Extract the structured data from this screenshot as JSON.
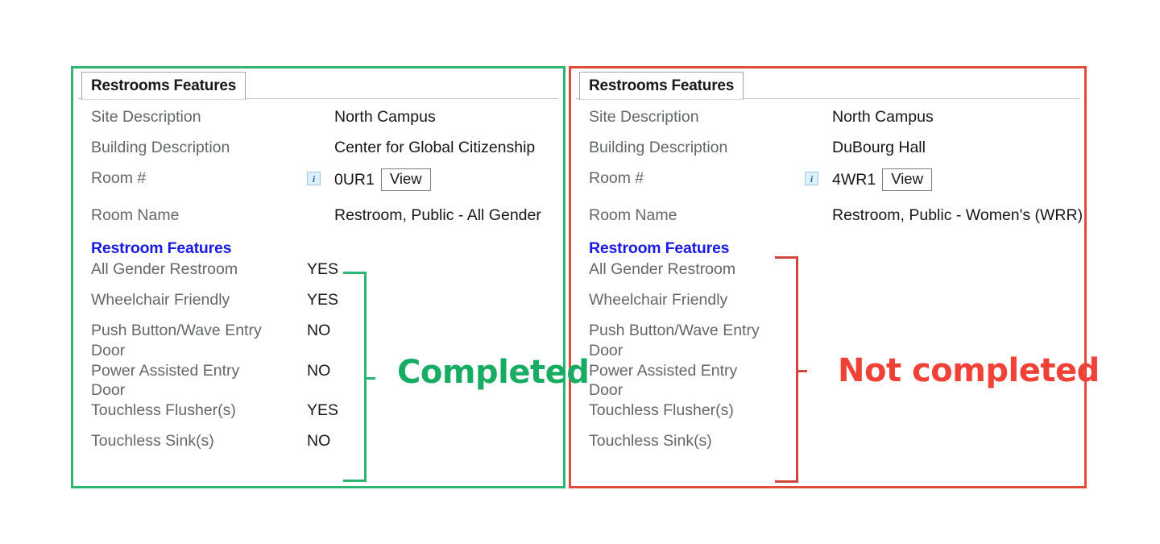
{
  "accent": {
    "green": "#2cb673",
    "red": "#e24a3b",
    "link_blue": "#1a1ae0",
    "label_gray": "#636769"
  },
  "panels": [
    {
      "status_key": "completed",
      "border_color": "#2cb673",
      "tab_label": "Restrooms Features",
      "info_icon": "info-icon",
      "fields": [
        {
          "label": "Site Description",
          "value": "North Campus",
          "has_info": false,
          "has_button": false
        },
        {
          "label": "Building Description",
          "value": "Center for Global Citizenship",
          "has_info": false,
          "has_button": false
        },
        {
          "label": "Room #",
          "value": "0UR1",
          "has_info": true,
          "has_button": true,
          "button_label": "View"
        },
        {
          "label": "Room Name",
          "value": "Restroom, Public - All Gender",
          "has_info": false,
          "has_button": false
        }
      ],
      "section_heading": "Restroom Features",
      "features": [
        {
          "label": "All Gender Restroom",
          "value": "YES"
        },
        {
          "label": "Wheelchair Friendly",
          "value": "YES"
        },
        {
          "label": "Push Button/Wave Entry\nDoor",
          "value": "NO"
        },
        {
          "label": "Power Assisted Entry\nDoor",
          "value": "NO"
        },
        {
          "label": "Touchless Flusher(s)",
          "value": "YES"
        },
        {
          "label": "Touchless Sink(s)",
          "value": "NO"
        }
      ],
      "annotation": "Completed",
      "annotation_color": "#18ac62"
    },
    {
      "status_key": "not_completed",
      "border_color": "#e24a3b",
      "tab_label": "Restrooms Features",
      "info_icon": "info-icon",
      "fields": [
        {
          "label": "Site Description",
          "value": "North Campus",
          "has_info": false,
          "has_button": false
        },
        {
          "label": "Building Description",
          "value": "DuBourg Hall",
          "has_info": false,
          "has_button": false
        },
        {
          "label": "Room #",
          "value": "4WR1",
          "has_info": true,
          "has_button": true,
          "button_label": "View"
        },
        {
          "label": "Room Name",
          "value": "Restroom, Public - Women's (WRR)",
          "has_info": false,
          "has_button": false
        }
      ],
      "section_heading": "Restroom Features",
      "features": [
        {
          "label": "All Gender Restroom",
          "value": ""
        },
        {
          "label": "Wheelchair Friendly",
          "value": ""
        },
        {
          "label": "Push Button/Wave Entry\nDoor",
          "value": ""
        },
        {
          "label": "Power Assisted Entry\nDoor",
          "value": ""
        },
        {
          "label": "Touchless Flusher(s)",
          "value": ""
        },
        {
          "label": "Touchless Sink(s)",
          "value": ""
        }
      ],
      "annotation": "Not completed",
      "annotation_color": "#ef4136"
    }
  ]
}
